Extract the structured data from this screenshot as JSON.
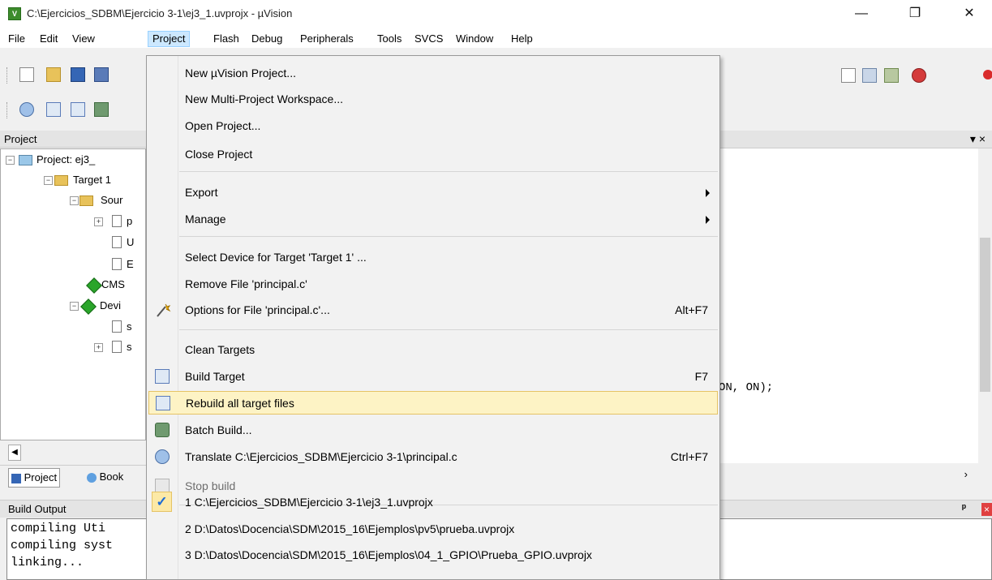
{
  "window": {
    "title": "C:\\Ejercicios_SDBM\\Ejercicio 3-1\\ej3_1.uvprojx - µVision",
    "app_icon_text": "V",
    "minimize_glyph": "—",
    "maximize_glyph": "❐",
    "close_glyph": "✕"
  },
  "menubar": [
    "File",
    "Edit",
    "View",
    "Project",
    "Flash",
    "Debug",
    "Peripherals",
    "Tools",
    "SVCS",
    "Window",
    "Help"
  ],
  "project_panel": {
    "title": "Project",
    "tree": [
      {
        "label": "Project: ej3_",
        "type": "project"
      },
      {
        "label": "Target 1",
        "type": "target"
      },
      {
        "label": "Sour",
        "type": "folder"
      },
      {
        "label": "p",
        "type": "file"
      },
      {
        "label": "U",
        "type": "file"
      },
      {
        "label": "E",
        "type": "file"
      },
      {
        "label": "CMS",
        "type": "component"
      },
      {
        "label": "Devi",
        "type": "component"
      },
      {
        "label": "s",
        "type": "file"
      },
      {
        "label": "s",
        "type": "file"
      }
    ],
    "tabs": [
      "Project",
      "Book"
    ]
  },
  "editor": {
    "code_fragment": "ON, ON);",
    "panel_controls": "▾ ×"
  },
  "build_output": {
    "title": "Build Output",
    "lines": [
      "compiling Uti",
      "compiling syst",
      "linking..."
    ],
    "pin_glyph": "ᵖ",
    "close_glyph": "×"
  },
  "project_menu": {
    "items": [
      {
        "label": "New µVision Project...",
        "shortcut": "",
        "submenu": false,
        "icon": "",
        "disabled": false
      },
      {
        "label": "New Multi-Project Workspace...",
        "shortcut": "",
        "submenu": false,
        "icon": "",
        "disabled": false
      },
      {
        "label": "Open Project...",
        "shortcut": "",
        "submenu": false,
        "icon": "",
        "disabled": false
      },
      {
        "label": "Close Project",
        "shortcut": "",
        "submenu": false,
        "icon": "",
        "disabled": false
      },
      {
        "label": "Export",
        "shortcut": "",
        "submenu": true,
        "icon": "",
        "disabled": false
      },
      {
        "label": "Manage",
        "shortcut": "",
        "submenu": true,
        "icon": "",
        "disabled": false
      },
      {
        "label": "Select Device for Target 'Target 1' ...",
        "shortcut": "",
        "submenu": false,
        "icon": "",
        "disabled": false
      },
      {
        "label": "Remove File 'principal.c'",
        "shortcut": "",
        "submenu": false,
        "icon": "",
        "disabled": false
      },
      {
        "label": "Options for File 'principal.c'...",
        "shortcut": "Alt+F7",
        "submenu": false,
        "icon": "options-wand-icon",
        "disabled": false
      },
      {
        "label": "Clean Targets",
        "shortcut": "",
        "submenu": false,
        "icon": "",
        "disabled": false
      },
      {
        "label": "Build Target",
        "shortcut": "F7",
        "submenu": false,
        "icon": "build-icon",
        "disabled": false
      },
      {
        "label": "Rebuild all target files",
        "shortcut": "",
        "submenu": false,
        "icon": "rebuild-icon",
        "disabled": false,
        "highlighted": true
      },
      {
        "label": "Batch Build...",
        "shortcut": "",
        "submenu": false,
        "icon": "batch-build-icon",
        "disabled": false
      },
      {
        "label": "Translate C:\\Ejercicios_SDBM\\Ejercicio 3-1\\principal.c",
        "shortcut": "Ctrl+F7",
        "submenu": false,
        "icon": "translate-icon",
        "disabled": false
      },
      {
        "label": "Stop build",
        "shortcut": "",
        "submenu": false,
        "icon": "stop-build-icon",
        "disabled": true
      },
      {
        "label": "1 C:\\Ejercicios_SDBM\\Ejercicio 3-1\\ej3_1.uvprojx",
        "shortcut": "",
        "submenu": false,
        "icon": "check-icon",
        "disabled": false,
        "checked": true
      },
      {
        "label": "2 D:\\Datos\\Docencia\\SDM\\2015_16\\Ejemplos\\pv5\\prueba.uvprojx",
        "shortcut": "",
        "submenu": false,
        "icon": "",
        "disabled": false
      },
      {
        "label": "3 D:\\Datos\\Docencia\\SDM\\2015_16\\Ejemplos\\04_1_GPIO\\Prueba_GPIO.uvprojx",
        "shortcut": "",
        "submenu": false,
        "icon": "",
        "disabled": false
      }
    ],
    "check_glyph": "✓"
  },
  "colors": {
    "menu_highlight": "#fdf3c5",
    "menu_highlight_border": "#e5c365",
    "active_menu": "#cce8ff",
    "app_icon": "#3d8c2c"
  }
}
